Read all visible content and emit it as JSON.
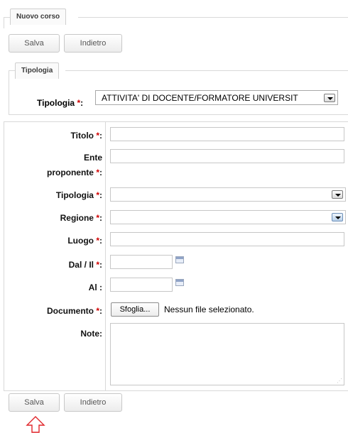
{
  "section": {
    "title": "Nuovo corso"
  },
  "toolbar_top": {
    "save_label": "Salva",
    "back_label": "Indietro"
  },
  "tipologia_section": {
    "title": "Tipologia",
    "label": "Tipologia",
    "value": "ATTIVITA' DI DOCENTE/FORMATORE UNIVERSIT"
  },
  "required_mark": "*",
  "colon": ":",
  "form": {
    "titolo_label": "Titolo",
    "ente_label_line1": "Ente",
    "ente_label_line2": "proponente",
    "tipologia_label": "Tipologia",
    "regione_label": "Regione",
    "luogo_label": "Luogo",
    "dal_label": "Dal / Il",
    "al_label": "Al :",
    "documento_label": "Documento",
    "browse_label": "Sfoglia...",
    "no_file_text": "Nessun file selezionato.",
    "note_label": "Note:"
  },
  "toolbar_bottom": {
    "save_label": "Salva",
    "back_label": "Indietro"
  },
  "colors": {
    "required": "#d00000",
    "border": "#c7c7c7",
    "pointer_arrow": "#e0262b"
  }
}
